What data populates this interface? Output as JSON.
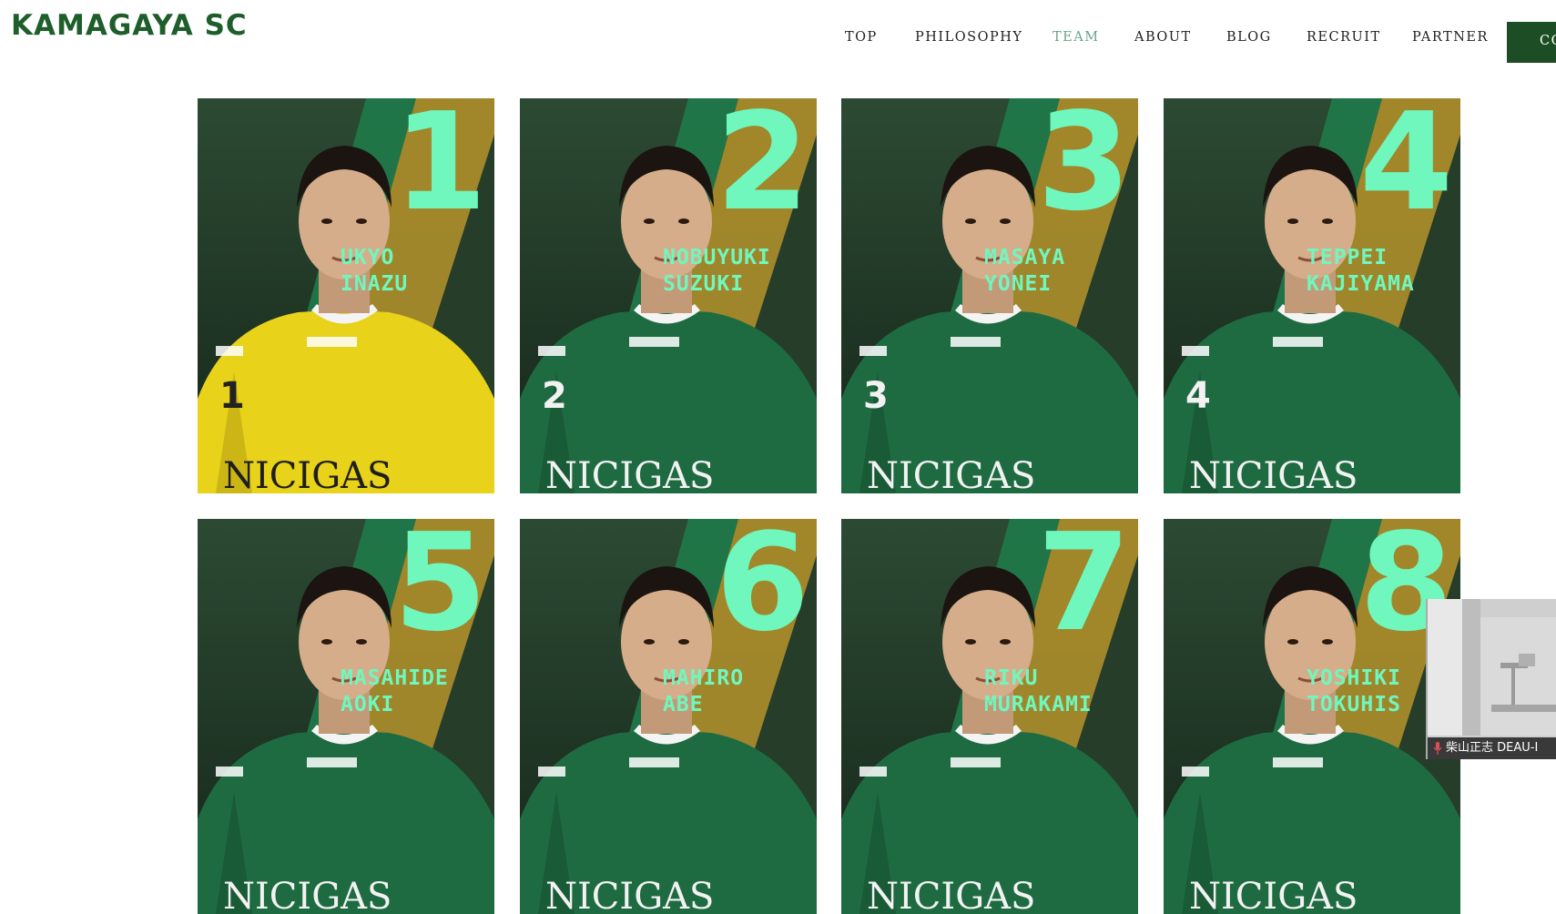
{
  "header": {
    "logo": "KAMAGAYA SC",
    "nav": [
      {
        "label": "TOP",
        "active": false
      },
      {
        "label": "PHILOSOPHY",
        "active": false
      },
      {
        "label": "TEAM",
        "active": true
      },
      {
        "label": "ABOUT",
        "active": false
      },
      {
        "label": "BLOG",
        "active": false
      },
      {
        "label": "RECRUIT",
        "active": false
      },
      {
        "label": "PARTNER",
        "active": false
      }
    ],
    "cta_label": "CO"
  },
  "players": [
    {
      "number": "1",
      "name": "UKYO\nINAZU",
      "kit": "yellow",
      "shirt_number": "1"
    },
    {
      "number": "2",
      "name": "NOBUYUKI\nSUZUKI",
      "kit": "green",
      "shirt_number": "2"
    },
    {
      "number": "3",
      "name": "MASAYA\nYONEI",
      "kit": "green",
      "shirt_number": "3"
    },
    {
      "number": "4",
      "name": "TEPPEI\nKAJIYAMA",
      "kit": "green",
      "shirt_number": "4"
    },
    {
      "number": "5",
      "name": "MASAHIDE\nAOKI",
      "kit": "green",
      "shirt_number": ""
    },
    {
      "number": "6",
      "name": "MAHIRO\nABE",
      "kit": "green",
      "shirt_number": ""
    },
    {
      "number": "7",
      "name": "RIKU\nMURAKAMI",
      "kit": "green",
      "shirt_number": ""
    },
    {
      "number": "8",
      "name": "YOSHIKI\nTOKUHIS",
      "kit": "green",
      "shirt_number": ""
    }
  ],
  "sponsor_text": "NICIGAS",
  "video_overlay": {
    "caption": "柴山正志 DEAU-I"
  },
  "colors": {
    "brand_green": "#1d5e2a",
    "accent_mint": "#6ff7be",
    "nav_active": "#6aa38a",
    "card_gold": "#a88a2a",
    "card_green": "#1f7a4a"
  }
}
